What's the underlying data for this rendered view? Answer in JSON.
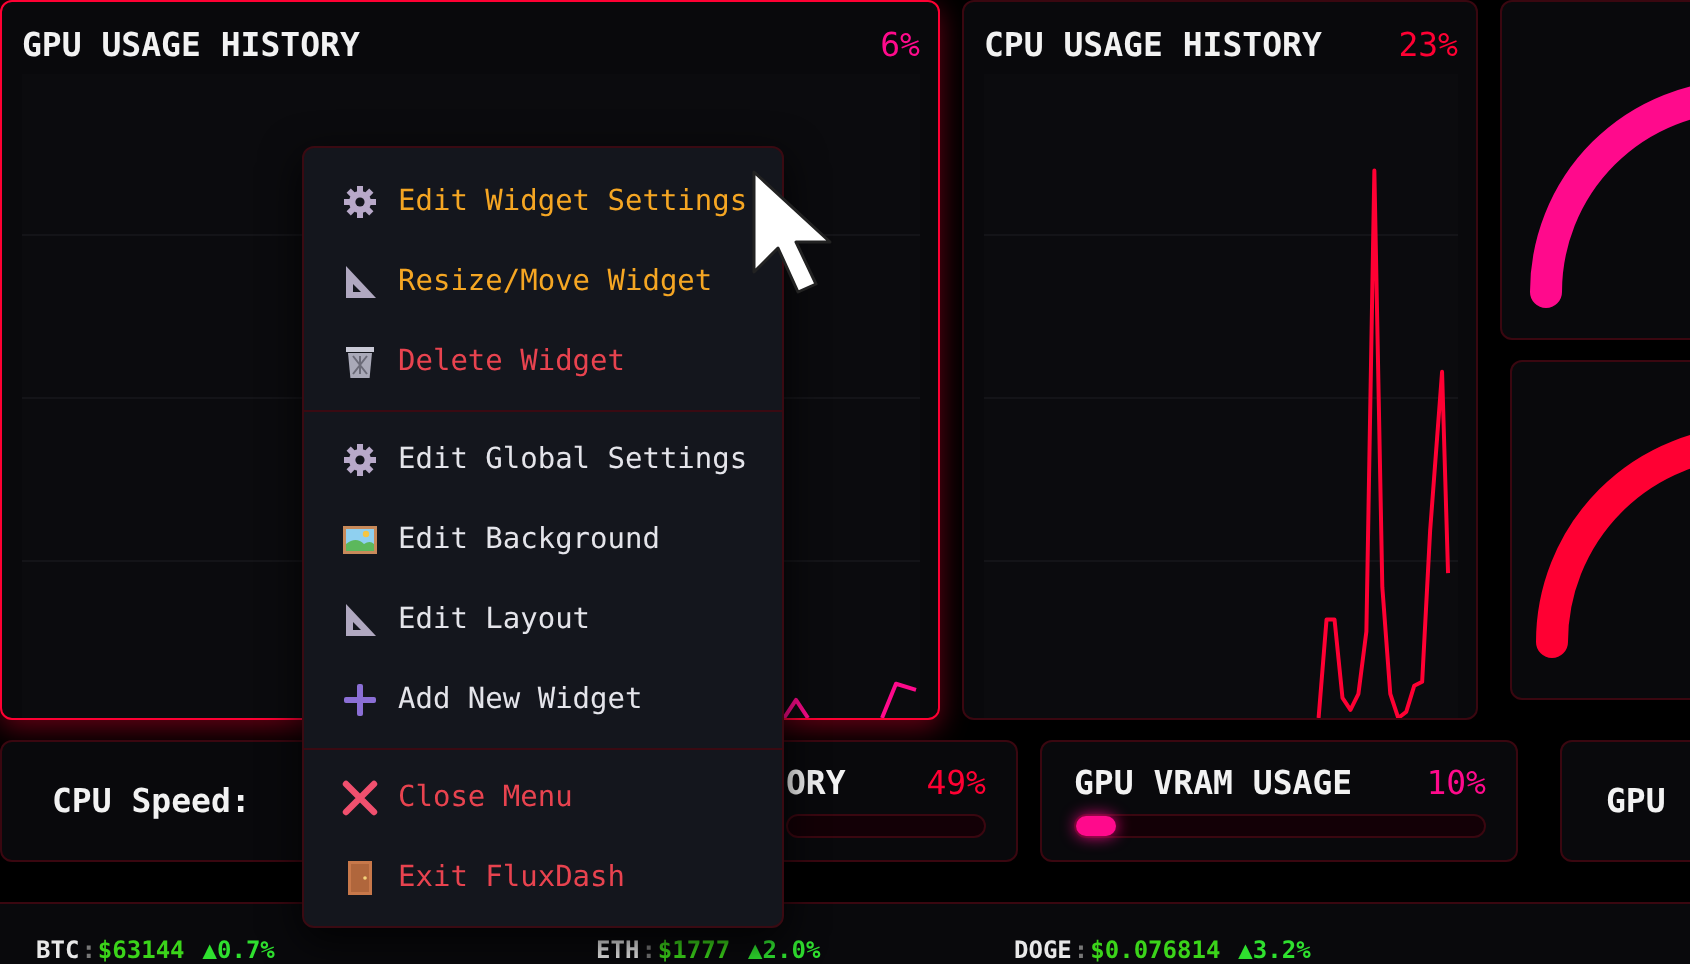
{
  "gpu_history": {
    "title": "GPU USAGE HISTORY",
    "value": "6%"
  },
  "cpu_history": {
    "title": "CPU USAGE HISTORY",
    "value": "23%"
  },
  "gauges": [
    {
      "color": "#ff0a8c"
    },
    {
      "color": "#ff0033"
    }
  ],
  "cpu_speed": {
    "label": "CPU Speed:"
  },
  "memory_usage": {
    "title": "ORY",
    "value": "49%"
  },
  "vram_usage": {
    "title": "GPU VRAM USAGE",
    "value": "10%",
    "level": 0.1
  },
  "gpu_card": {
    "title": "GPU"
  },
  "ticker": [
    {
      "symbol": "BTC",
      "separator": ":",
      "price": "$63144",
      "change": "▲0.7%"
    },
    {
      "symbol": "ETH",
      "separator": ":",
      "price": "$1777",
      "change": "▲2.0%"
    },
    {
      "symbol": "DOGE",
      "separator": ":",
      "price": "$0.076814",
      "change": "▲3.2%"
    }
  ],
  "context_menu": {
    "sections": [
      {
        "items": [
          {
            "label": "Edit Widget Settings",
            "kind": "widget"
          },
          {
            "label": "Resize/Move Widget",
            "kind": "widget"
          },
          {
            "label": "Delete Widget",
            "kind": "danger"
          }
        ]
      },
      {
        "items": [
          {
            "label": "Edit Global Settings",
            "kind": "plain"
          },
          {
            "label": "Edit Background",
            "kind": "plain"
          },
          {
            "label": "Edit Layout",
            "kind": "plain"
          },
          {
            "label": "Add New Widget",
            "kind": "plain"
          }
        ]
      },
      {
        "items": [
          {
            "label": "Close Menu",
            "kind": "danger"
          },
          {
            "label": "Exit FluxDash",
            "kind": "danger"
          }
        ]
      }
    ]
  }
}
